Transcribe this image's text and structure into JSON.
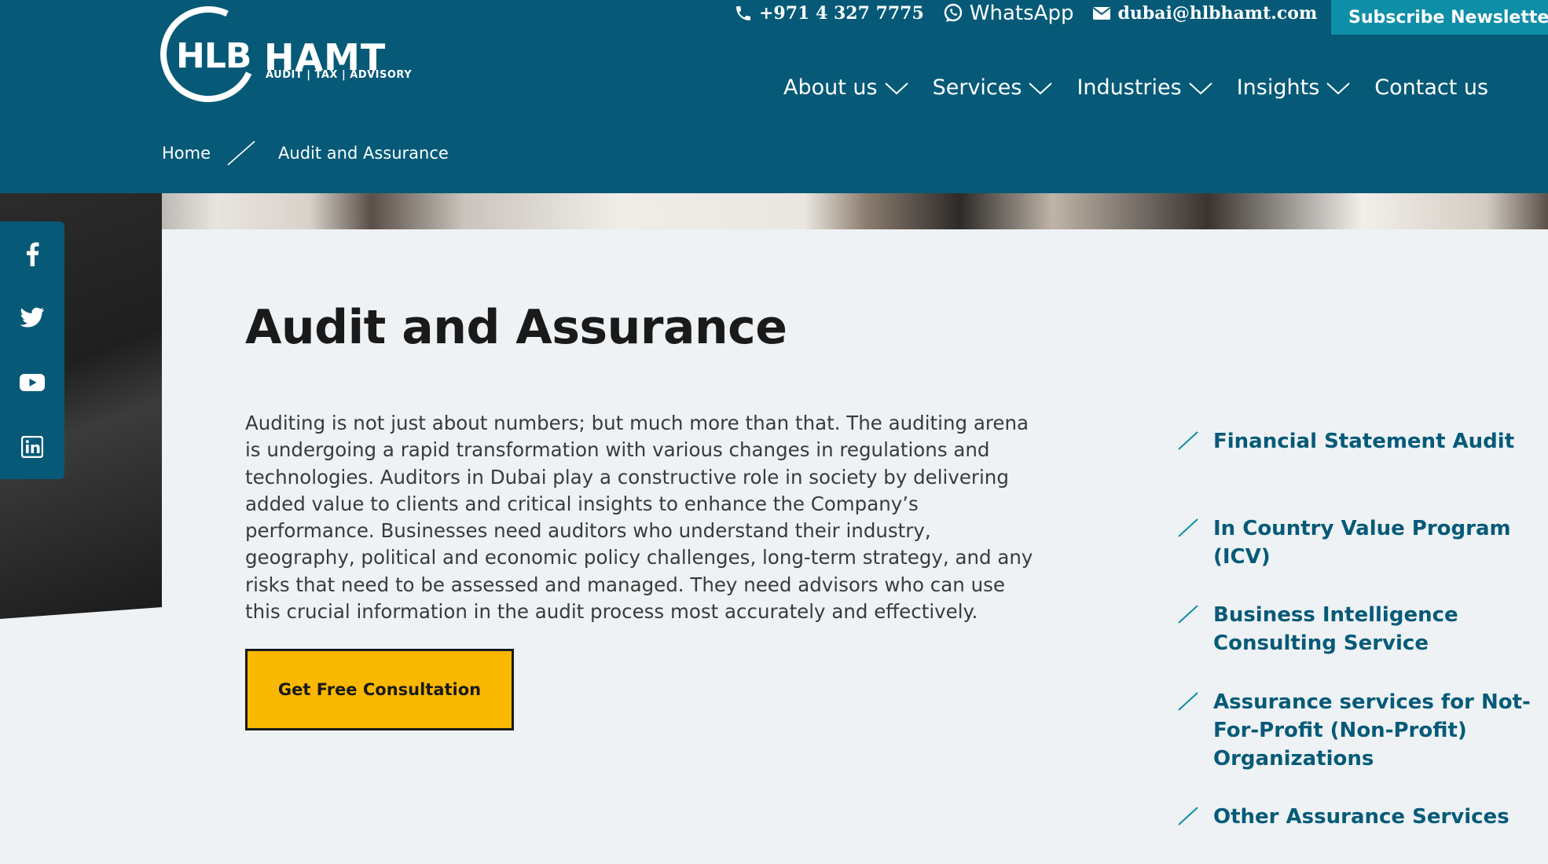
{
  "header": {
    "logo": {
      "mark": "HLB",
      "name": "HAMT",
      "tagline": "AUDIT | TAX | ADVISORY"
    },
    "contact": {
      "phone": "+971 4 327 7775",
      "whatsapp": "WhatsApp",
      "email": "dubai@hlbhamt.com"
    },
    "subscribe_label": "Subscribe Newsletter",
    "nav": [
      {
        "label": "About us",
        "dropdown": true
      },
      {
        "label": "Services",
        "dropdown": true
      },
      {
        "label": "Industries",
        "dropdown": true
      },
      {
        "label": "Insights",
        "dropdown": true
      },
      {
        "label": "Contact us",
        "dropdown": false
      }
    ],
    "breadcrumb": [
      "Home",
      "Audit and Assurance"
    ]
  },
  "social": [
    "facebook-icon",
    "twitter-icon",
    "youtube-icon",
    "linkedin-icon"
  ],
  "main": {
    "title": "Audit and Assurance",
    "intro": "Auditing is not just about numbers; but much more than that. The auditing arena is undergoing a rapid transformation with various changes in regulations and technologies. Auditors in Dubai play a constructive role in society by delivering added value to clients and critical insights to enhance the Company’s performance. Businesses need auditors who understand their industry, geography, political and economic policy challenges, long-term strategy, and any risks that need to be assessed and managed. They need advisors who can use this crucial information in the audit process most accurately and effectively.",
    "cta_label": "Get Free Consultation"
  },
  "services": [
    "Financial Statement Audit",
    "In Country Value Program (ICV)",
    "Business Intelligence Consulting Service",
    "Assurance services for Not-For-Profit (Non-Profit) Organizations",
    "Other Assurance Services"
  ],
  "colors": {
    "brand": "#065a78",
    "accent": "#0f8ea8",
    "cta": "#fab800",
    "background": "#eef2f4"
  }
}
